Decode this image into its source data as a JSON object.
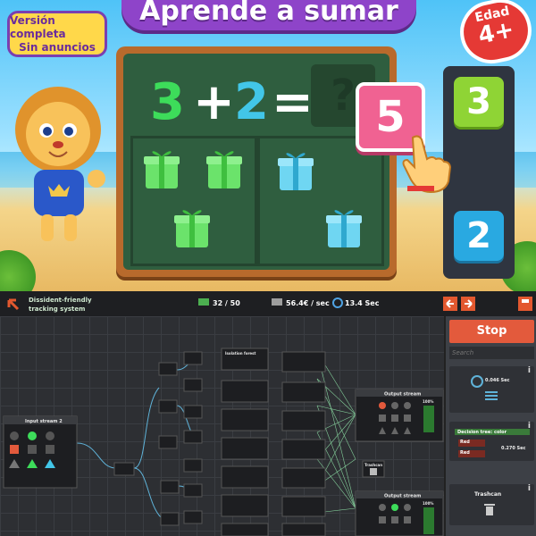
{
  "math_game": {
    "title": "Aprende a sumar",
    "promo_line1": "Versión completa",
    "promo_line2": "Sin anuncios",
    "age_label": "Edad",
    "age_value": "4+",
    "equation": {
      "a": "3",
      "plus": "+",
      "b": "2",
      "equals": "=",
      "unknown": "?"
    },
    "answer_card": "5",
    "options": [
      "3",
      "2"
    ],
    "colors": {
      "green": "#3ddc5a",
      "blue": "#42c6e8",
      "pink": "#f06292",
      "purple": "#8e44c9"
    }
  },
  "factory_game": {
    "tagline_line1": "Dissident-friendly",
    "tagline_line2": "tracking system",
    "counter": "32 / 50",
    "income": "56.4€ / sec",
    "speed": "13.4 Sec",
    "stop_label": "Stop",
    "search_placeholder": "Search",
    "input_node_title": "Input stream 2",
    "output_node_title_1": "Output stream",
    "output_node_title_2": "Output stream",
    "output_percent_1": "100%",
    "output_percent_2": "100%",
    "trashcan_label": "Trashcan",
    "isolation_label": "Isolation forest",
    "side_items": {
      "timer_value": "0.046 Sec",
      "decision_title": "Decision tree: color",
      "decision_opt1": "Red",
      "decision_opt2": "Red",
      "decision_value": "0.270 Sec",
      "trashcan": "Trashcan"
    },
    "info_glyph": "i"
  }
}
